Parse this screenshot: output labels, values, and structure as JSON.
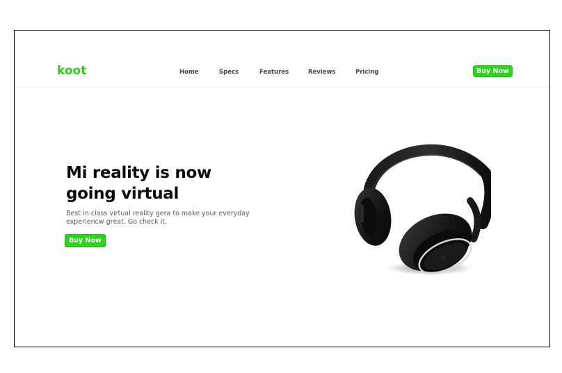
{
  "brand": {
    "name": "koot",
    "color": "#2ecc1a"
  },
  "nav": {
    "links": [
      {
        "label": "Home"
      },
      {
        "label": "Specs"
      },
      {
        "label": "Features"
      },
      {
        "label": "Reviews"
      },
      {
        "label": "Pricing"
      }
    ],
    "cta_label": "Buy Now"
  },
  "hero": {
    "title": "Mi reality is now going virtual",
    "description": "Best in class virtual reality gera to make your everyday experiencw great. Go check it.",
    "cta_label": "Buy Now"
  },
  "product": {
    "image": "black-headphones",
    "accent": "#2ad61c"
  }
}
